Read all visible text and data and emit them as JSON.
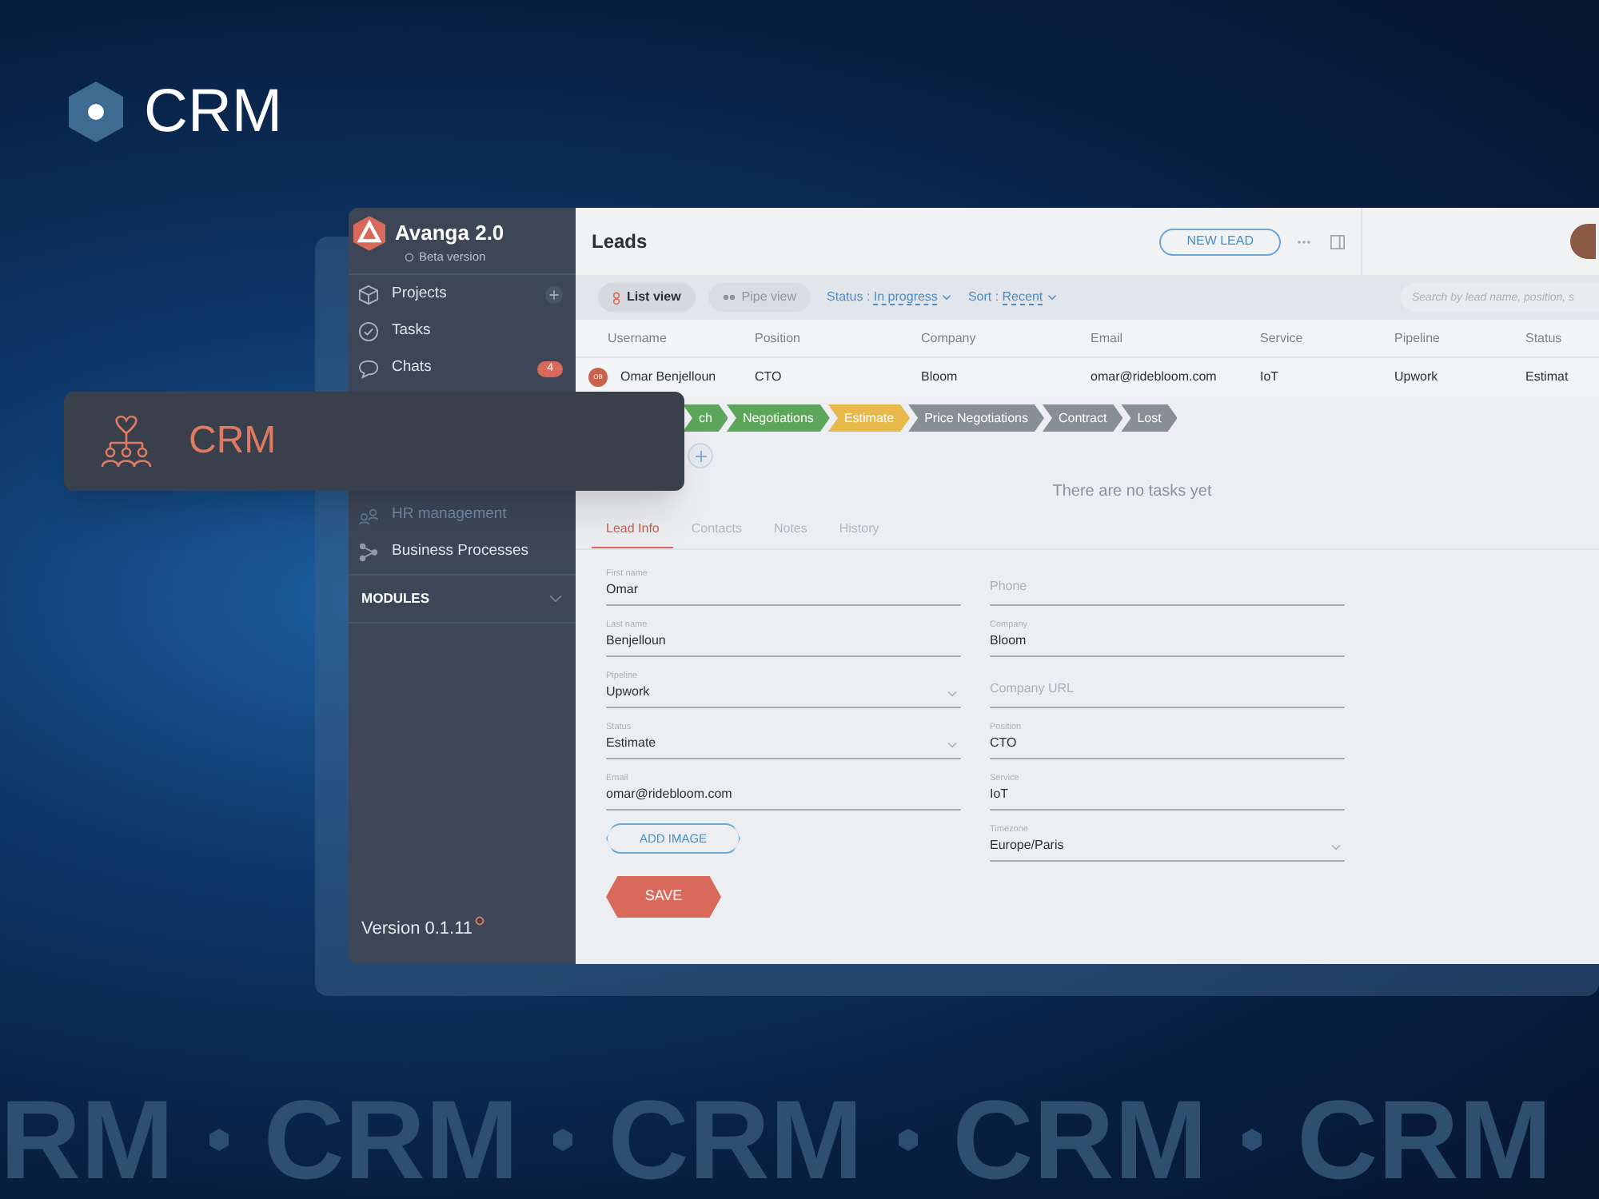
{
  "brand": {
    "title": "CRM"
  },
  "sidebar": {
    "app_name": "Avanga 2.0",
    "subtitle": "Beta version",
    "items": [
      {
        "label": "Projects",
        "kind": "projects",
        "addable": true
      },
      {
        "label": "Tasks",
        "kind": "tasks",
        "addable": false
      },
      {
        "label": "Chats",
        "kind": "chats",
        "badge": "4",
        "addable": false
      }
    ],
    "lower_items": [
      {
        "label": "HR management",
        "kind": "hr"
      },
      {
        "label": "Business Processes",
        "kind": "processes"
      }
    ],
    "section": "MODULES",
    "version": "Version 0.1.11"
  },
  "highlight_card": {
    "label": "CRM"
  },
  "header": {
    "title": "Leads",
    "new_button": "NEW LEAD"
  },
  "toolbar": {
    "views": [
      {
        "label": "List view",
        "selected": true
      },
      {
        "label": "Pipe view",
        "selected": false
      }
    ],
    "filters": [
      {
        "label": "Status : ",
        "value": "In progress"
      },
      {
        "label": "Sort : ",
        "value": "Recent"
      }
    ],
    "search": {
      "placeholder": "Search by lead name, position, s"
    }
  },
  "table": {
    "columns": [
      "Username",
      "Position",
      "Company",
      "Email",
      "Service",
      "Pipeline",
      "Status"
    ],
    "rows": [
      {
        "initials": "OB",
        "cells": [
          "Omar Benjelloun",
          "CTO",
          "Bloom",
          "omar@ridebloom.com",
          "IoT",
          "Upwork",
          "Estimat"
        ]
      }
    ]
  },
  "pipeline": [
    {
      "label": "ch",
      "color": "#5ba65b"
    },
    {
      "label": "Negotiations",
      "color": "#5ba65b"
    },
    {
      "label": "Estimate",
      "color": "#e6b94a"
    },
    {
      "label": "Price Negotiations",
      "color": "#878f95"
    },
    {
      "label": "Contract",
      "color": "#878f95"
    },
    {
      "label": "Lost",
      "color": "#878f95"
    }
  ],
  "tasks_empty": "There are no tasks yet",
  "detail_tabs": [
    {
      "label": "Lead Info",
      "selected": true
    },
    {
      "label": "Contacts",
      "selected": false
    },
    {
      "label": "Notes",
      "selected": false
    },
    {
      "label": "History",
      "selected": false
    }
  ],
  "form": {
    "left": [
      {
        "kind": "text",
        "label": "First name",
        "value": "Omar"
      },
      {
        "kind": "text",
        "label": "Last name",
        "value": "Benjelloun"
      },
      {
        "kind": "select",
        "label": "Pipeline",
        "value": "Upwork"
      },
      {
        "kind": "select",
        "label": "Status",
        "value": "Estimate"
      },
      {
        "kind": "text",
        "label": "Email",
        "value": "omar@ridebloom.com"
      }
    ],
    "right": [
      {
        "kind": "text",
        "placeholder": "Phone"
      },
      {
        "kind": "text",
        "label": "Company",
        "value": "Bloom"
      },
      {
        "kind": "text",
        "placeholder": "Company URL"
      },
      {
        "kind": "text",
        "label": "Position",
        "value": "CTO"
      },
      {
        "kind": "text",
        "label": "Service",
        "value": "IoT"
      },
      {
        "kind": "select",
        "label": "Timezone",
        "value": "Europe/Paris"
      }
    ],
    "add_image": "ADD IMAGE",
    "save": "SAVE"
  },
  "banner_words": [
    "RM",
    "CRM",
    "CRM",
    "CRM",
    "CRM"
  ]
}
